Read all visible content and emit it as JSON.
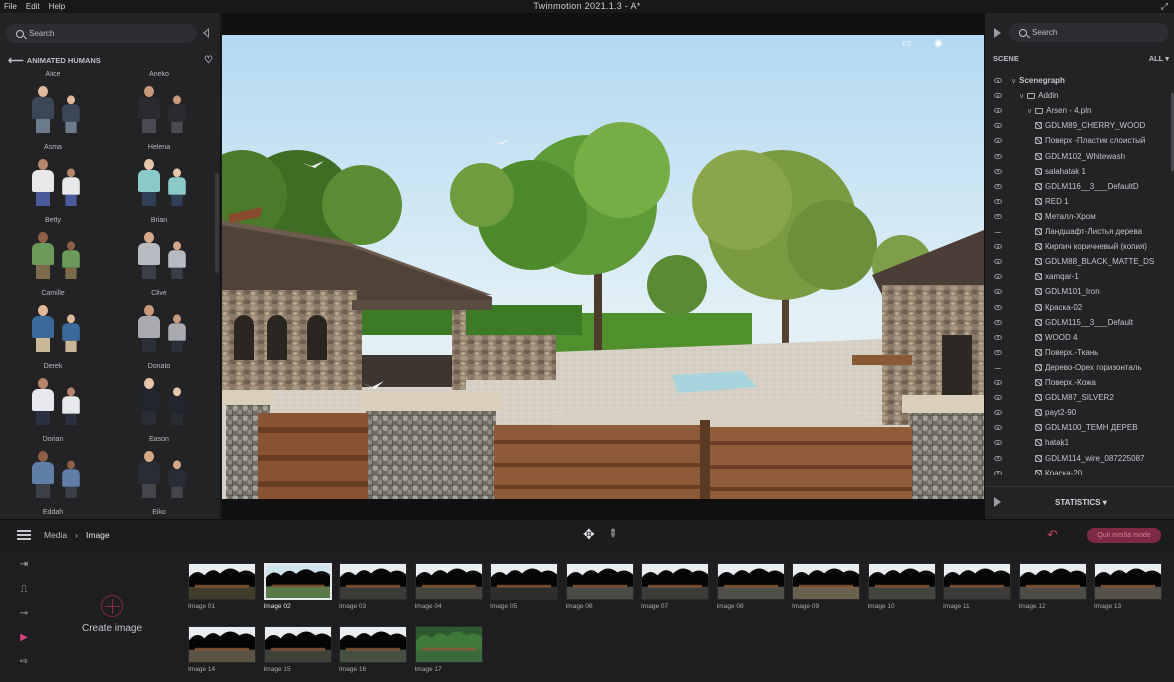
{
  "app": {
    "title": "Twinmotion 2021.1.3 - A*",
    "menu": [
      "File",
      "Edit",
      "Help"
    ]
  },
  "left_panel": {
    "search_placeholder": "Search",
    "section_title": "ANIMATED HUMANS",
    "humans": [
      "Alice",
      "Aneko",
      "Asma",
      "Helena",
      "Betty",
      "Brian",
      "Camille",
      "Clive",
      "Derek",
      "Donato",
      "Dorian",
      "Eason",
      "Eddah",
      "Eiko"
    ]
  },
  "right_panel": {
    "search_placeholder": "Search",
    "scene_label": "SCENE",
    "filter_label": "ALL",
    "tree": [
      {
        "label": "Scenegraph",
        "level": 0,
        "kind": "root",
        "visible": true
      },
      {
        "label": "Addin",
        "level": 1,
        "kind": "folder",
        "visible": true
      },
      {
        "label": "Arsen - 4.pln",
        "level": 2,
        "kind": "folder",
        "visible": true
      },
      {
        "label": "GDLM89_CHERRY_WOOD",
        "level": 3,
        "kind": "mat",
        "visible": true
      },
      {
        "label": "Поверх -Пластик слоистый",
        "level": 3,
        "kind": "mat",
        "visible": true
      },
      {
        "label": "GDLM102_Whitewash",
        "level": 3,
        "kind": "mat",
        "visible": true
      },
      {
        "label": "salahatak 1",
        "level": 3,
        "kind": "mat",
        "visible": true
      },
      {
        "label": "GDLM116__3___DefaultD",
        "level": 3,
        "kind": "mat",
        "visible": true
      },
      {
        "label": "RED 1",
        "level": 3,
        "kind": "mat",
        "visible": true
      },
      {
        "label": "Металл-Хром",
        "level": 3,
        "kind": "mat",
        "visible": true
      },
      {
        "label": "Ландшафт-Листья дерева",
        "level": 3,
        "kind": "mat",
        "visible": false
      },
      {
        "label": "Кирпич коричневый (копия)",
        "level": 3,
        "kind": "mat",
        "visible": true
      },
      {
        "label": "GDLM88_BLACK_MATTE_DS",
        "level": 3,
        "kind": "mat",
        "visible": true
      },
      {
        "label": "xamqar-1",
        "level": 3,
        "kind": "mat",
        "visible": true
      },
      {
        "label": "GDLM101_Iron",
        "level": 3,
        "kind": "mat",
        "visible": true
      },
      {
        "label": "Краска-02",
        "level": 3,
        "kind": "mat",
        "visible": true
      },
      {
        "label": "GDLM115__3___Default",
        "level": 3,
        "kind": "mat",
        "visible": true
      },
      {
        "label": "WOOD 4",
        "level": 3,
        "kind": "mat",
        "visible": true
      },
      {
        "label": "Поверх.-Ткань",
        "level": 3,
        "kind": "mat",
        "visible": true
      },
      {
        "label": "Дерево-Орех горизонталь",
        "level": 3,
        "kind": "mat",
        "visible": false
      },
      {
        "label": "Поверх.-Кожа",
        "level": 3,
        "kind": "mat",
        "visible": true
      },
      {
        "label": "GDLM87_SILVER2",
        "level": 3,
        "kind": "mat",
        "visible": true
      },
      {
        "label": "payt2-90",
        "level": 3,
        "kind": "mat",
        "visible": true
      },
      {
        "label": "GDLM100_ТЕМН ДЕРЕВ",
        "level": 3,
        "kind": "mat",
        "visible": true
      },
      {
        "label": "hatak1",
        "level": 3,
        "kind": "mat",
        "visible": true
      },
      {
        "label": "GDLM114_wire_087225087",
        "level": 3,
        "kind": "mat",
        "visible": true
      },
      {
        "label": "Краска-20",
        "level": 3,
        "kind": "mat",
        "visible": true
      }
    ],
    "statistics_label": "STATISTICS"
  },
  "toolbar": {
    "breadcrumb": [
      "Media",
      "Image"
    ],
    "quit_label": "Quit media mode"
  },
  "media": {
    "create_label": "Create image",
    "selected_index": 1,
    "images": [
      "Image 01",
      "Image 02",
      "Image 03",
      "Image 04",
      "Image 05",
      "Image 06",
      "Image 07",
      "Image 08",
      "Image 09",
      "Image 10",
      "Image 11",
      "Image 12",
      "Image 13",
      "Image 14",
      "Image 15",
      "Image 16",
      "Image 17"
    ]
  },
  "colors": {
    "accent": "#c0475e",
    "panel": "#232326",
    "background": "#1e1e20"
  }
}
